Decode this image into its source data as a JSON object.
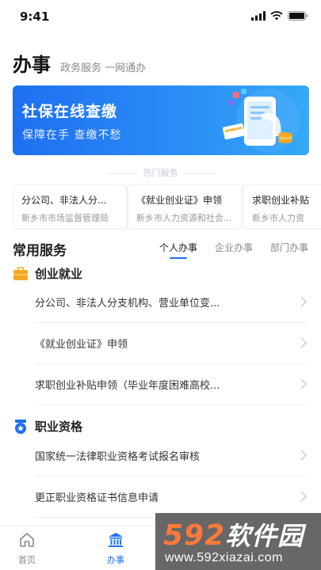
{
  "status_bar": {
    "time": "9:41"
  },
  "header": {
    "title": "办事",
    "subtitle": "政务服务 一网通办"
  },
  "banner": {
    "title": "社保在线查缴",
    "subtitle": "保障在手  查缴不愁",
    "accent": "#1e6ff0"
  },
  "hot": {
    "label": "热门服务",
    "cards": [
      {
        "title": "分公司、非法人分...",
        "sub": "新乡市市场监督管理局"
      },
      {
        "title": "《就业创业证》申领",
        "sub": "新乡市人力资源和社会..."
      },
      {
        "title": "求职创业补贴",
        "sub": "新乡市人力资"
      }
    ]
  },
  "common": {
    "title": "常用服务",
    "tabs": [
      "个人办事",
      "企业办事",
      "部门办事"
    ],
    "active_tab": 0
  },
  "categories": [
    {
      "name": "创业就业",
      "icon": "briefcase-icon",
      "items": [
        "分公司、非法人分支机构、营业单位变...",
        "《就业创业证》申领",
        "求职创业补贴申领（毕业年度困难高校..."
      ]
    },
    {
      "name": "职业资格",
      "icon": "badge-icon",
      "items": [
        "国家统一法律职业资格考试报名审核",
        "更正职业资格证书信息申请"
      ]
    }
  ],
  "tab_bar": {
    "items": [
      {
        "label": "首页",
        "icon": "home-icon"
      },
      {
        "label": "办事",
        "icon": "government-building-icon"
      }
    ],
    "active": 1
  },
  "watermark": {
    "brand_num": "592",
    "brand_cn": "软件园",
    "url": "www.592xiazai.com"
  },
  "colors": {
    "primary": "#1d6ff0",
    "orange": "#f5a623"
  }
}
